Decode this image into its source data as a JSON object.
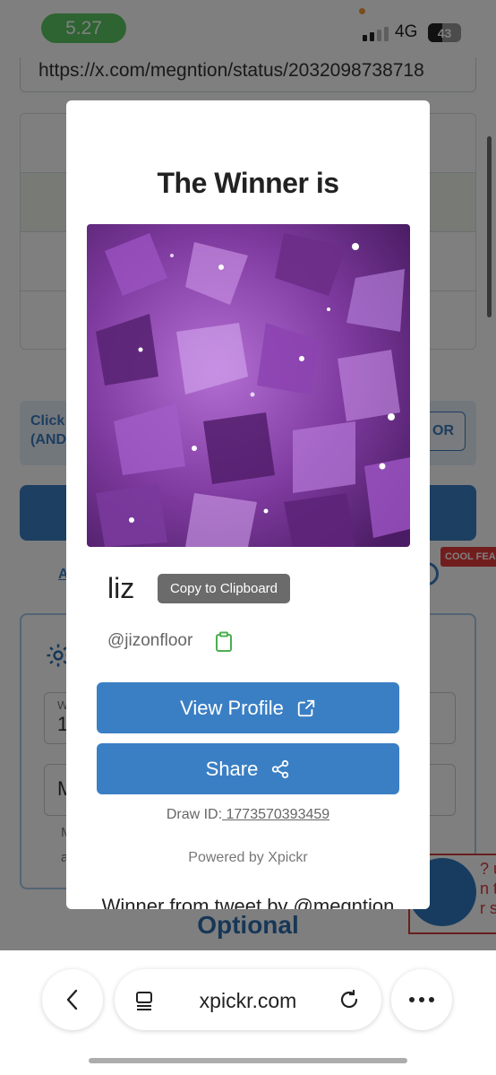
{
  "status_bar": {
    "time": "5.27",
    "network": "4G",
    "battery": "43",
    "battery_level": 0.43
  },
  "page": {
    "url_value": "https://x.com/megntion/status/2032098738718",
    "info_text_line1": "Click",
    "info_text_line2": "(AND",
    "info_button": "OR",
    "link_left": "A",
    "cool_badge": "COOL FEA",
    "field1_label": "W",
    "field1_value": "1",
    "field2_value": "M",
    "small_line1": "M",
    "small_line2": "a",
    "optional_heading": "Optional",
    "red_note_lines": [
      "? ur",
      "n ti",
      "r situ"
    ]
  },
  "modal": {
    "title": "The Winner is",
    "winner_name": "liz",
    "tooltip": "Copy to Clipboard",
    "handle": "@jizonfloor",
    "view_profile": "View Profile",
    "share": "Share",
    "draw_id_label": "Draw ID:",
    "draw_id_value": " 1773570393459",
    "powered_by": "Powered by Xpickr",
    "winner_from": "Winner from tweet by @megntion"
  },
  "browser": {
    "address": "xpickr.com"
  },
  "colors": {
    "accent_blue": "#3a7fc4",
    "status_green": "#5ac862",
    "clipboard_green": "#4caf50",
    "alert_red": "#e43b3b"
  },
  "icons": {
    "clipboard": "clipboard-icon",
    "external_link": "external-link-icon",
    "share": "share-icon",
    "back": "chevron-left-icon",
    "more": "more-dots-icon",
    "reader": "reader-icon",
    "reload": "reload-icon",
    "settings": "gear-icon"
  }
}
